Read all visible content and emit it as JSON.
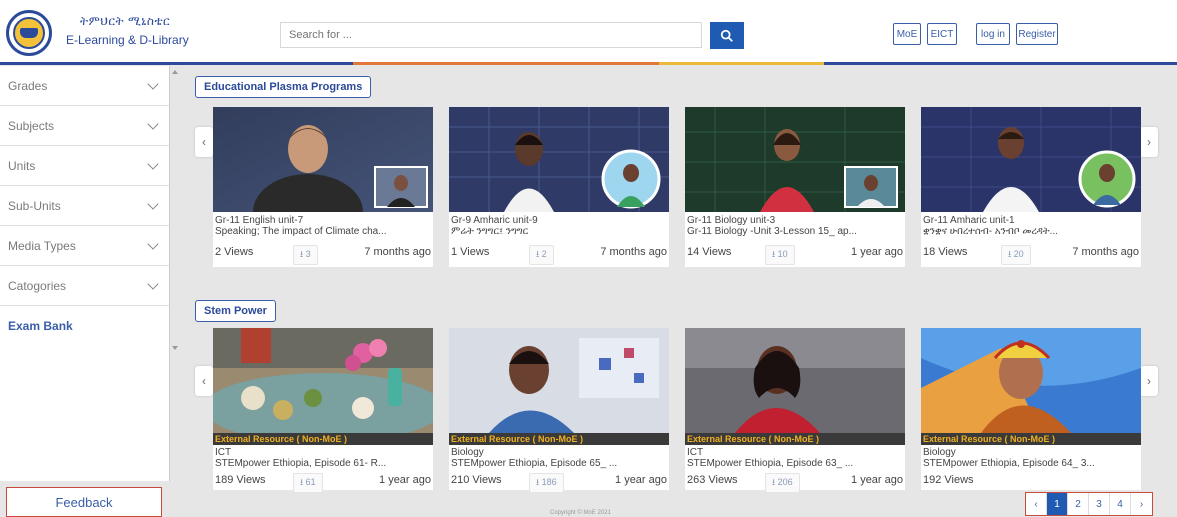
{
  "header": {
    "brand_line1": "ትምህርት ሚኒስቴር",
    "brand_line2": "E-Learning & D-Library",
    "search_placeholder": "Search for ...",
    "buttons": [
      "MoE",
      "EICT",
      "log in",
      "Register"
    ]
  },
  "sidebar": {
    "items": [
      {
        "label": "Grades"
      },
      {
        "label": "Subjects"
      },
      {
        "label": "Units"
      },
      {
        "label": "Sub-Units"
      },
      {
        "label": "Media Types"
      },
      {
        "label": "Catogories"
      },
      {
        "label": "Exam Bank"
      }
    ],
    "feedback_label": "Feedback"
  },
  "sections": [
    {
      "title": "Educational Plasma Programs",
      "cards": [
        {
          "line1": "Gr-11 English unit-7",
          "line2": "Speaking; The impact of Climate cha...",
          "views": "2 Views",
          "downloads": "3",
          "time": "7 months ago"
        },
        {
          "line1": "Gr-9 Amharic unit-9",
          "line2": "ምሬት ንግግር፤ ንግግር",
          "views": "1 Views",
          "downloads": "2",
          "time": "7 months ago"
        },
        {
          "line1": "Gr-11 Biology unit-3",
          "line2": "Gr-11 Biology -Unit 3-Lesson 15_ ap...",
          "views": "14 Views",
          "downloads": "10",
          "time": "1 year ago"
        },
        {
          "line1": "Gr-11 Amharic unit-1",
          "line2": "ቋንቋና ሁበረተሰብ- አንብቦ መረዳት...",
          "views": "18 Views",
          "downloads": "20",
          "time": "7 months ago"
        }
      ]
    },
    {
      "title": "Stem Power",
      "cards": [
        {
          "band": "External Resource ( Non-MoE )",
          "line1": "ICT",
          "line2": "STEMpower Ethiopia, Episode 61- R...",
          "views": "189 Views",
          "downloads": "61",
          "time": "1 year ago"
        },
        {
          "band": "External Resource ( Non-MoE )",
          "line1": "Biology",
          "line2": "STEMpower Ethiopia, Episode 65_ ...",
          "views": "210 Views",
          "downloads": "186",
          "time": "1 year ago"
        },
        {
          "band": "External Resource ( Non-MoE )",
          "line1": "ICT",
          "line2": "STEMpower Ethiopia, Episode 63_ ...",
          "views": "263 Views",
          "downloads": "206",
          "time": "1 year ago"
        },
        {
          "band": "External Resource ( Non-MoE )",
          "line1": "Biology",
          "line2": "STEMpower Ethiopia, Episode 64_ 3...",
          "views": "192 Views",
          "downloads": "",
          "time": ""
        }
      ]
    }
  ],
  "pagination": {
    "pages": [
      "1",
      "2",
      "3",
      "4"
    ],
    "active": "1"
  },
  "footer": {
    "copyright": "Copyright © MoE 2021"
  },
  "colors": {
    "primary": "#2c4a9a",
    "accent": "#e0783c",
    "button_blue": "#1f5bb3",
    "band_text": "#f0b020"
  }
}
